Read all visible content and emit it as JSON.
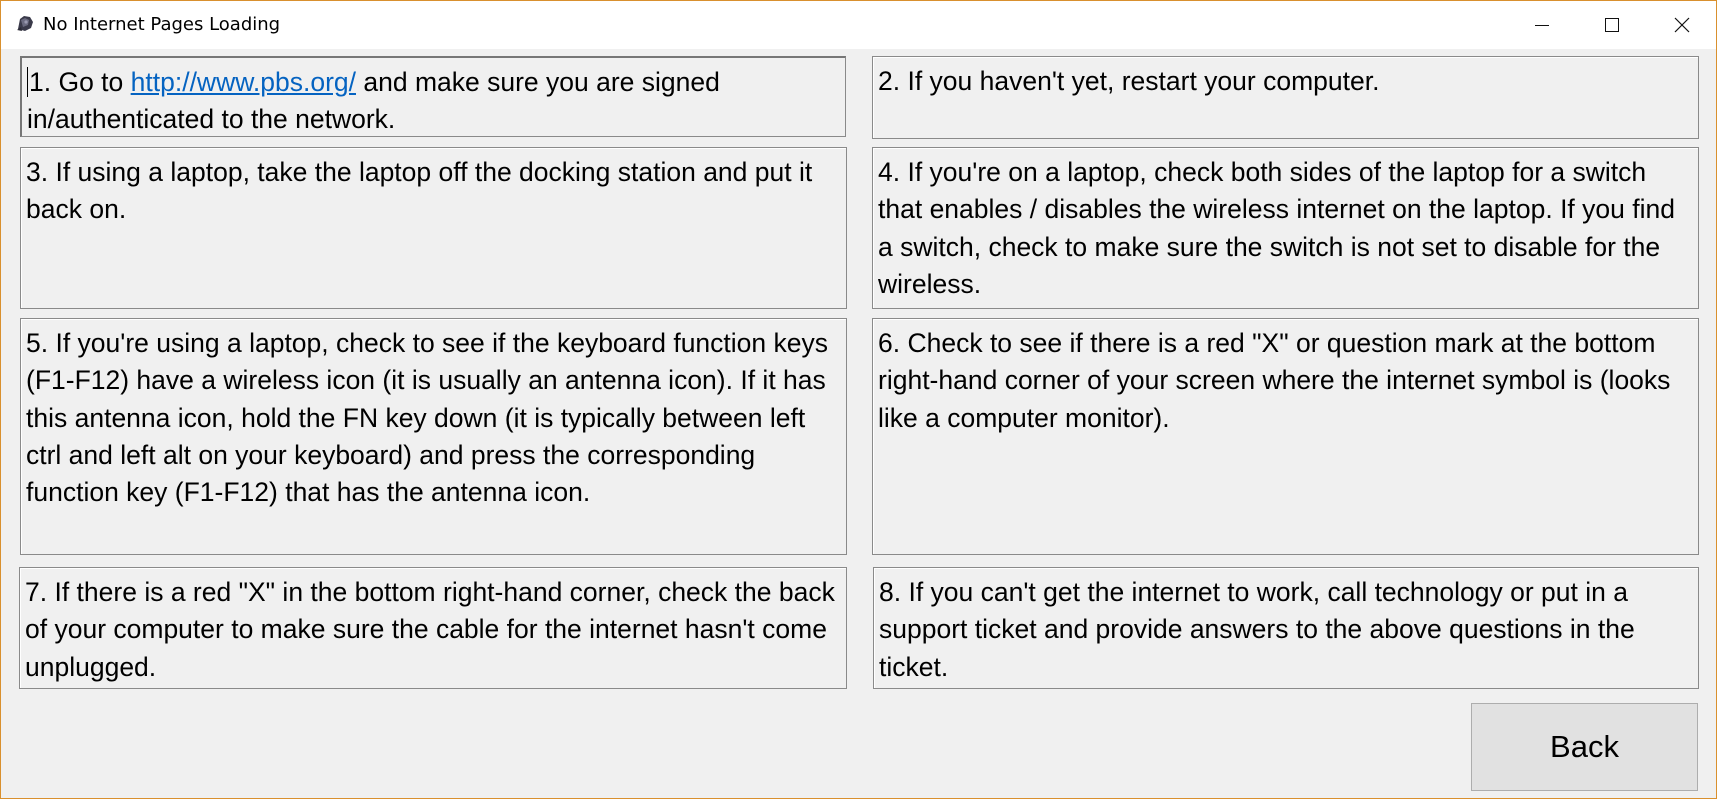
{
  "window": {
    "title": "No Internet Pages Loading",
    "app_icon": "app-icon",
    "controls": [
      "minimize-icon",
      "maximize-icon",
      "close-icon"
    ]
  },
  "steps": [
    {
      "number": "1",
      "before_link": "1. Go to ",
      "link": "http://www.pbs.org/",
      "after_link": " and make sure you are signed in/authenticated to the network."
    },
    {
      "number": "2",
      "text": "2. If you haven't yet, restart your computer."
    },
    {
      "number": "3",
      "text": "3. If using a laptop, take the laptop off the docking station and put it back on."
    },
    {
      "number": "4",
      "text": "4. If you're on a laptop, check both sides of the laptop for a switch that enables / disables the wireless internet on the laptop. If you find a switch, check to make sure the switch is not set to disable for the wireless."
    },
    {
      "number": "5",
      "text": "5. If you're using a laptop, check to see if the keyboard function keys (F1-F12) have a wireless icon (it is usually an antenna icon). If it has this antenna icon, hold the FN key down (it is typically between left ctrl and left alt on your keyboard) and press the corresponding function key (F1-F12) that has the antenna icon."
    },
    {
      "number": "6",
      "text": "6. Check to see if there is a red \"X\" or question mark at the bottom right-hand corner of your screen where the internet symbol is (looks like a computer monitor)."
    },
    {
      "number": "7",
      "text": "7. If there is a red \"X\" in the bottom right-hand corner, check the back of your computer to make sure the cable for the internet hasn't come unplugged."
    },
    {
      "number": "8",
      "text": "8. If you can't get the internet to work, call technology or put in a support ticket and provide answers to the above questions in the ticket."
    }
  ],
  "back_button": {
    "label": "Back"
  },
  "colors": {
    "window_border": "#d9902e",
    "background": "#f0f0f0",
    "link": "#0563c1",
    "button_face": "#e1e1e1"
  }
}
